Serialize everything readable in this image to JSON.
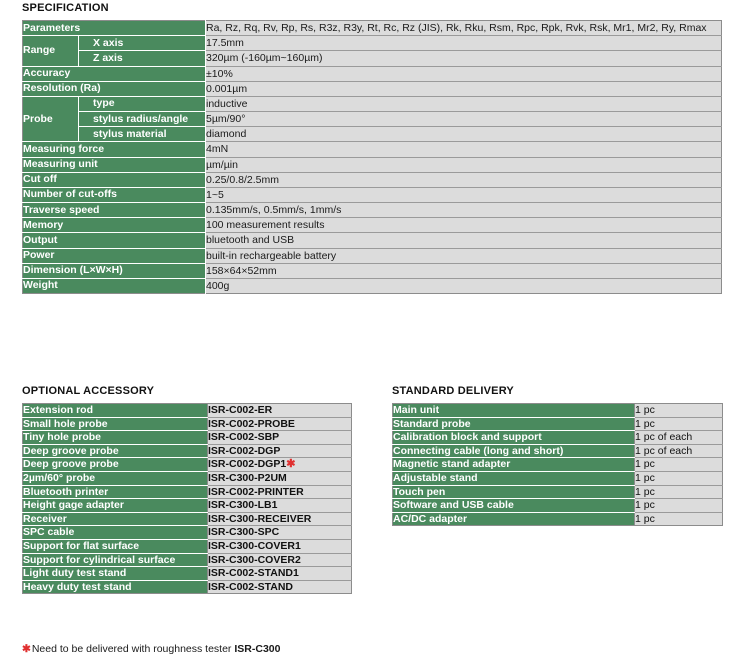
{
  "specification": {
    "title": "SPECIFICATION",
    "rows": [
      {
        "label": "Parameters",
        "sub": null,
        "value": "Ra, Rz, Rq, Rv, Rp, Rs, R3z, R3y, Rt, Rc, Rz (JIS), Rk, Rku, Rsm, Rpc, Rpk, Rvk, Rsk, Mr1, Mr2, Ry, Rmax"
      },
      {
        "label": "Range",
        "sub": "X axis",
        "value": "17.5mm"
      },
      {
        "label": "Range",
        "sub": "Z axis",
        "value": "320µm (-160µm~160µm)"
      },
      {
        "label": "Accuracy",
        "sub": null,
        "value": "±10%"
      },
      {
        "label": "Resolution (Ra)",
        "sub": null,
        "value": "0.001µm"
      },
      {
        "label": "Probe",
        "sub": "type",
        "value": "inductive"
      },
      {
        "label": "Probe",
        "sub": "stylus radius/angle",
        "value": "5µm/90°"
      },
      {
        "label": "Probe",
        "sub": "stylus material",
        "value": "diamond"
      },
      {
        "label": "Measuring force",
        "sub": null,
        "value": "4mN"
      },
      {
        "label": "Measuring unit",
        "sub": null,
        "value": "µm/µin"
      },
      {
        "label": "Cut off",
        "sub": null,
        "value": "0.25/0.8/2.5mm"
      },
      {
        "label": "Number of cut-offs",
        "sub": null,
        "value": "1~5"
      },
      {
        "label": "Traverse speed",
        "sub": null,
        "value": "0.135mm/s, 0.5mm/s, 1mm/s"
      },
      {
        "label": "Memory",
        "sub": null,
        "value": "100 measurement results"
      },
      {
        "label": "Output",
        "sub": null,
        "value": "bluetooth and USB"
      },
      {
        "label": "Power",
        "sub": null,
        "value": "built-in rechargeable battery"
      },
      {
        "label": "Dimension (L×W×H)",
        "sub": null,
        "value": "158×64×52mm"
      },
      {
        "label": "Weight",
        "sub": null,
        "value": "400g"
      }
    ]
  },
  "optional_accessory": {
    "title": "OPTIONAL ACCESSORY",
    "rows": [
      {
        "name": "Extension rod",
        "code": "ISR-C002-ER",
        "star": false
      },
      {
        "name": "Small hole probe",
        "code": "ISR-C002-PROBE",
        "star": false
      },
      {
        "name": "Tiny hole probe",
        "code": "ISR-C002-SBP",
        "star": false
      },
      {
        "name": "Deep groove probe",
        "code": "ISR-C002-DGP",
        "star": false
      },
      {
        "name": "Deep groove probe",
        "code": "ISR-C002-DGP1",
        "star": true
      },
      {
        "name": "2µm/60° probe",
        "code": "ISR-C300-P2UM",
        "star": false
      },
      {
        "name": "Bluetooth printer",
        "code": "ISR-C002-PRINTER",
        "star": false
      },
      {
        "name": "Height gage adapter",
        "code": "ISR-C300-LB1",
        "star": false
      },
      {
        "name": "Receiver",
        "code": "ISR-C300-RECEIVER",
        "star": false
      },
      {
        "name": "SPC cable",
        "code": "ISR-C300-SPC",
        "star": false
      },
      {
        "name": "Support for flat surface",
        "code": "ISR-C300-COVER1",
        "star": false
      },
      {
        "name": "Support for cylindrical surface",
        "code": "ISR-C300-COVER2",
        "star": false
      },
      {
        "name": "Light duty test stand",
        "code": "ISR-C002-STAND1",
        "star": false
      },
      {
        "name": "Heavy duty test stand",
        "code": "ISR-C002-STAND",
        "star": false
      }
    ]
  },
  "standard_delivery": {
    "title": "STANDARD DELIVERY",
    "rows": [
      {
        "name": "Main unit",
        "qty": "1 pc"
      },
      {
        "name": "Standard probe",
        "qty": "1 pc"
      },
      {
        "name": "Calibration block and support",
        "qty": "1 pc of each"
      },
      {
        "name": "Connecting cable (long and short)",
        "qty": "1 pc of each"
      },
      {
        "name": "Magnetic stand adapter",
        "qty": "1 pc"
      },
      {
        "name": "Adjustable stand",
        "qty": "1 pc"
      },
      {
        "name": "Touch pen",
        "qty": "1 pc"
      },
      {
        "name": "Software and USB cable",
        "qty": "1 pc"
      },
      {
        "name": "AC/DC adapter",
        "qty": "1 pc"
      }
    ]
  },
  "footnote": {
    "star": "✱",
    "text": "Need to be delivered with roughness tester ",
    "bold": "ISR-C300"
  },
  "colors": {
    "green": "#4a8a5e",
    "value_bg": "#dcdcdc",
    "border": "#8c8c8c",
    "star_red": "#e03030"
  }
}
